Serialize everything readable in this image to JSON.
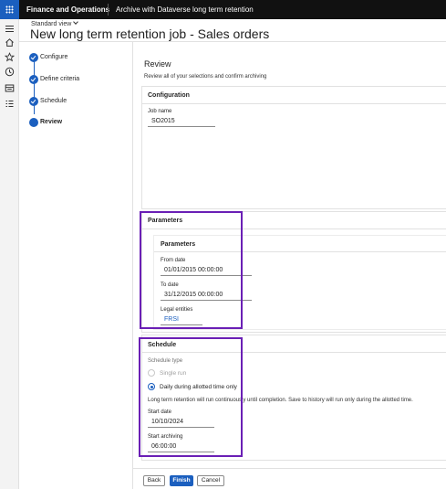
{
  "app": {
    "name": "Finance and Operations",
    "page_crumb": "Archive with Dataverse long term retention"
  },
  "header": {
    "view_name": "Standard view",
    "title": "New long term retention job - Sales orders"
  },
  "rail": {
    "icons": [
      "hamburger-icon",
      "home-icon",
      "star-icon",
      "clock-icon",
      "workspace-icon",
      "list-icon"
    ]
  },
  "steps": [
    {
      "label": "Configure",
      "state": "done"
    },
    {
      "label": "Define criteria",
      "state": "done"
    },
    {
      "label": "Schedule",
      "state": "done"
    },
    {
      "label": "Review",
      "state": "current"
    }
  ],
  "review": {
    "title": "Review",
    "subtitle": "Review all of your selections and confirm archiving",
    "configuration": {
      "heading": "Configuration",
      "job_name_label": "Job name",
      "job_name_value": "SO2015"
    },
    "parameters": {
      "heading": "Parameters",
      "inner_heading": "Parameters",
      "from_date_label": "From date",
      "from_date_value": "01/01/2015 00:00:00",
      "to_date_label": "To date",
      "to_date_value": "31/12/2015 00:00:00",
      "legal_entities_label": "Legal entities",
      "legal_entities_value": "FRSI"
    },
    "schedule": {
      "heading": "Schedule",
      "type_label": "Schedule type",
      "option_single": "Single run",
      "option_daily": "Daily during allotted time only",
      "selected": "daily",
      "note": "Long term retention will run continuously until completion. Save to history will run only during the allotted time.",
      "start_date_label": "Start date",
      "start_date_value": "10/10/2024",
      "start_archiving_label": "Start archiving",
      "start_archiving_value": "06:00:00"
    }
  },
  "footer": {
    "back": "Back",
    "finish": "Finish",
    "cancel": "Cancel"
  },
  "colors": {
    "accent": "#1b5fbf",
    "highlight": "#6a1fb5",
    "topbar": "#111111"
  }
}
